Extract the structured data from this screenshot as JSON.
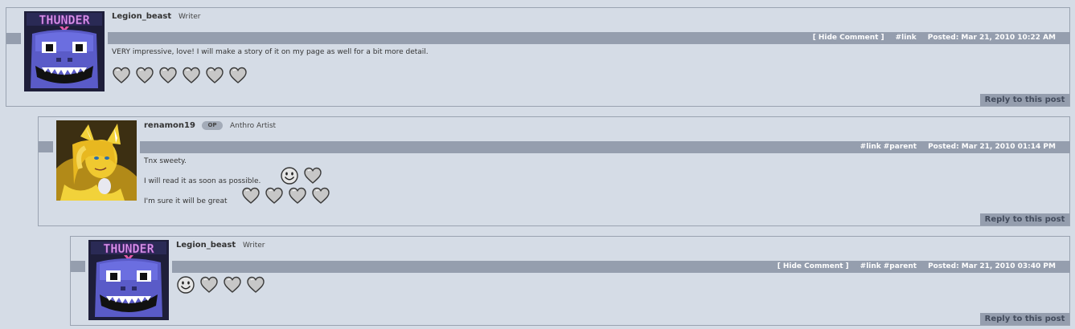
{
  "comments": [
    {
      "username": "Legion_beast",
      "role": "Writer",
      "avatar_name": "thunder-avatar",
      "actions": {
        "hide": "Hide Comment",
        "link": "#link",
        "parent": ""
      },
      "posted": "Posted: Mar 21, 2010 10:22 AM",
      "lines": [
        "VERY impressive, love! I will make a story of it on my page as well for a bit more detail."
      ],
      "emotes": [
        "heart",
        "heart",
        "heart",
        "heart",
        "heart",
        "heart"
      ],
      "reply_label": "Reply to this post"
    },
    {
      "username": "renamon19",
      "op_badge": "OP",
      "role": "Anthro Artist",
      "avatar_name": "renamon-avatar",
      "actions": {
        "hide": "",
        "link": "#link",
        "parent": "#parent"
      },
      "posted": "Posted: Mar 21, 2010 01:14 PM",
      "lines": [
        "Tnx sweety.",
        "I will read it as soon as possible.",
        "I'm sure it will be great"
      ],
      "line2_emotes": [
        "smile",
        "heart"
      ],
      "line3_emotes": [
        "heart",
        "heart",
        "heart",
        "heart"
      ],
      "reply_label": "Reply to this post"
    },
    {
      "username": "Legion_beast",
      "role": "Writer",
      "avatar_name": "thunder-avatar",
      "actions": {
        "hide": "Hide Comment",
        "link": "#link",
        "parent": "#parent"
      },
      "posted": "Posted: Mar 21, 2010 03:40 PM",
      "emotes": [
        "smile",
        "heart",
        "heart",
        "heart"
      ],
      "reply_label": "Reply to this post"
    }
  ],
  "hide_bracket_open": "[",
  "hide_bracket_close": "]",
  "colors": {
    "background": "#d5dce6",
    "bar": "#959eae",
    "border": "#9aa3b1"
  }
}
